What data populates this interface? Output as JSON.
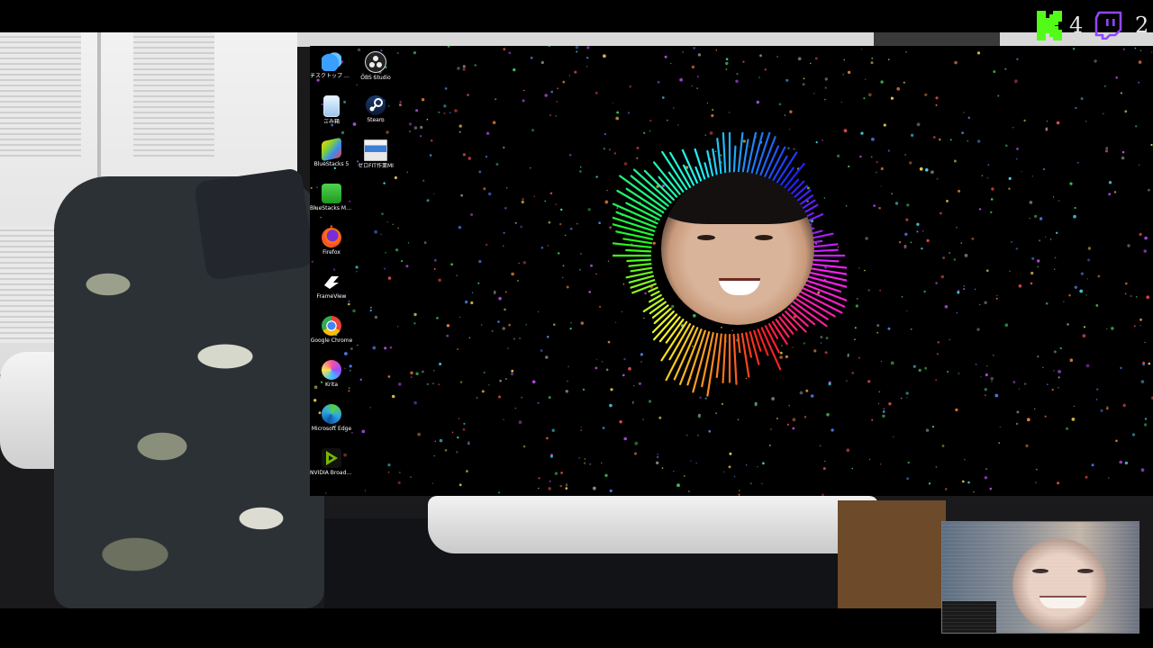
{
  "hud": {
    "kick_icon": "kick-logo-icon",
    "kick_viewers": "4",
    "kick_color": "#53fc18",
    "twitch_icon": "twitch-logo-icon",
    "twitch_viewers": "2",
    "twitch_color": "#9146ff"
  },
  "desktop": {
    "icons": [
      {
        "label": "デスクトップ へのショートカット (OneDri...",
        "icon": "onedrive-icon"
      },
      {
        "label": "OBS Studio",
        "icon": "obs-icon"
      },
      {
        "label": "ごみ箱",
        "icon": "recycle-bin-icon"
      },
      {
        "label": "Steam",
        "icon": "steam-icon"
      },
      {
        "label": "BlueStacks 5",
        "icon": "bluestacks-icon"
      },
      {
        "label": "ゼロFIT作業MI",
        "icon": "app-window-icon"
      },
      {
        "label": "BlueStacks Multi-Instanc...",
        "icon": "bluestacks-multi-icon"
      },
      {
        "label": "Firefox",
        "icon": "firefox-icon"
      },
      {
        "label": "FrameView",
        "icon": "frameview-icon"
      },
      {
        "label": "Google Chrome",
        "icon": "chrome-icon"
      },
      {
        "label": "Krita",
        "icon": "krita-icon"
      },
      {
        "label": "Microsoft Edge",
        "icon": "edge-icon"
      },
      {
        "label": "NVIDIA Broadcast",
        "icon": "nvidia-broadcast-icon"
      }
    ]
  }
}
